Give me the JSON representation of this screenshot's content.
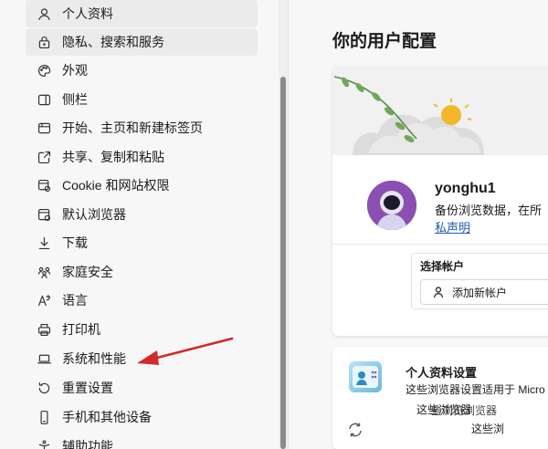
{
  "sidebar": {
    "items": [
      {
        "label": "个人资料",
        "icon": "person-icon"
      },
      {
        "label": "隐私、搜索和服务",
        "icon": "lock-icon"
      },
      {
        "label": "外观",
        "icon": "palette-icon"
      },
      {
        "label": "侧栏",
        "icon": "sidebar-icon"
      },
      {
        "label": "开始、主页和新建标签页",
        "icon": "home-tab-icon"
      },
      {
        "label": "共享、复制和粘贴",
        "icon": "share-icon"
      },
      {
        "label": "Cookie 和网站权限",
        "icon": "site-permissions-icon"
      },
      {
        "label": "默认浏览器",
        "icon": "browser-icon"
      },
      {
        "label": "下载",
        "icon": "download-icon"
      },
      {
        "label": "家庭安全",
        "icon": "family-icon"
      },
      {
        "label": "语言",
        "icon": "language-icon"
      },
      {
        "label": "打印机",
        "icon": "printer-icon"
      },
      {
        "label": "系统和性能",
        "icon": "laptop-icon"
      },
      {
        "label": "重置设置",
        "icon": "reset-icon"
      },
      {
        "label": "手机和其他设备",
        "icon": "phone-icon"
      },
      {
        "label": "辅助功能",
        "icon": "accessibility-icon"
      }
    ]
  },
  "main": {
    "title": "你的用户配置",
    "profile": {
      "username": "yonghu1",
      "sync_text": "备份浏览数据，在所",
      "privacy_link": "私声明",
      "account_label": "选择帐户",
      "add_account": "添加新帐户"
    },
    "settings": {
      "title": "个人资料设置",
      "desc": "这些浏览器设置适用于 Micro",
      "overlay1": "这些浏览器",
      "overlay2": "些浏览浏览器",
      "overlay3": "这些浏"
    }
  },
  "colors": {
    "accent": "#1f5fa8",
    "annotation_arrow": "#d12a2a",
    "avatar": "#8a4fb0"
  }
}
